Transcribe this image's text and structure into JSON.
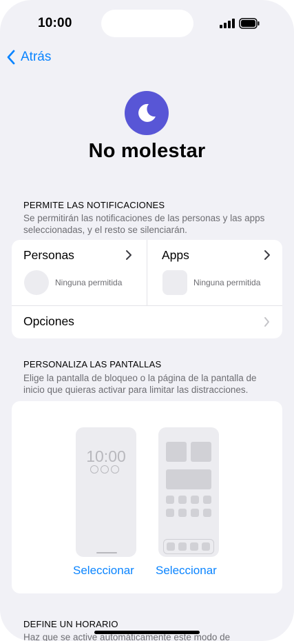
{
  "status_bar": {
    "time": "10:00"
  },
  "nav": {
    "back_label": "Atrás"
  },
  "header": {
    "title": "No molestar",
    "icon": "moon-icon",
    "icon_bg": "#5856d6"
  },
  "allow_notifications": {
    "heading": "PERMITE LAS NOTIFICACIONES",
    "description": "Se permitirán las notificaciones de las personas y las apps seleccionadas, y el resto se silenciarán.",
    "people": {
      "label": "Personas",
      "status": "Ninguna permitida"
    },
    "apps": {
      "label": "Apps",
      "status": "Ninguna permitida"
    },
    "options_label": "Opciones"
  },
  "customize_screens": {
    "heading": "PERSONALIZA LAS PANTALLAS",
    "description": "Elige la pantalla de bloqueo o la página de la pantalla de inicio que quieras activar para limitar las distracciones.",
    "lock_preview_time": "10:00",
    "lock_select_label": "Seleccionar",
    "home_select_label": "Seleccionar"
  },
  "schedule": {
    "heading": "DEFINE UN HORARIO",
    "description": "Haz que se active automáticamente este modo de"
  },
  "colors": {
    "accent": "#0a84ff",
    "background": "#f1f1f6"
  }
}
